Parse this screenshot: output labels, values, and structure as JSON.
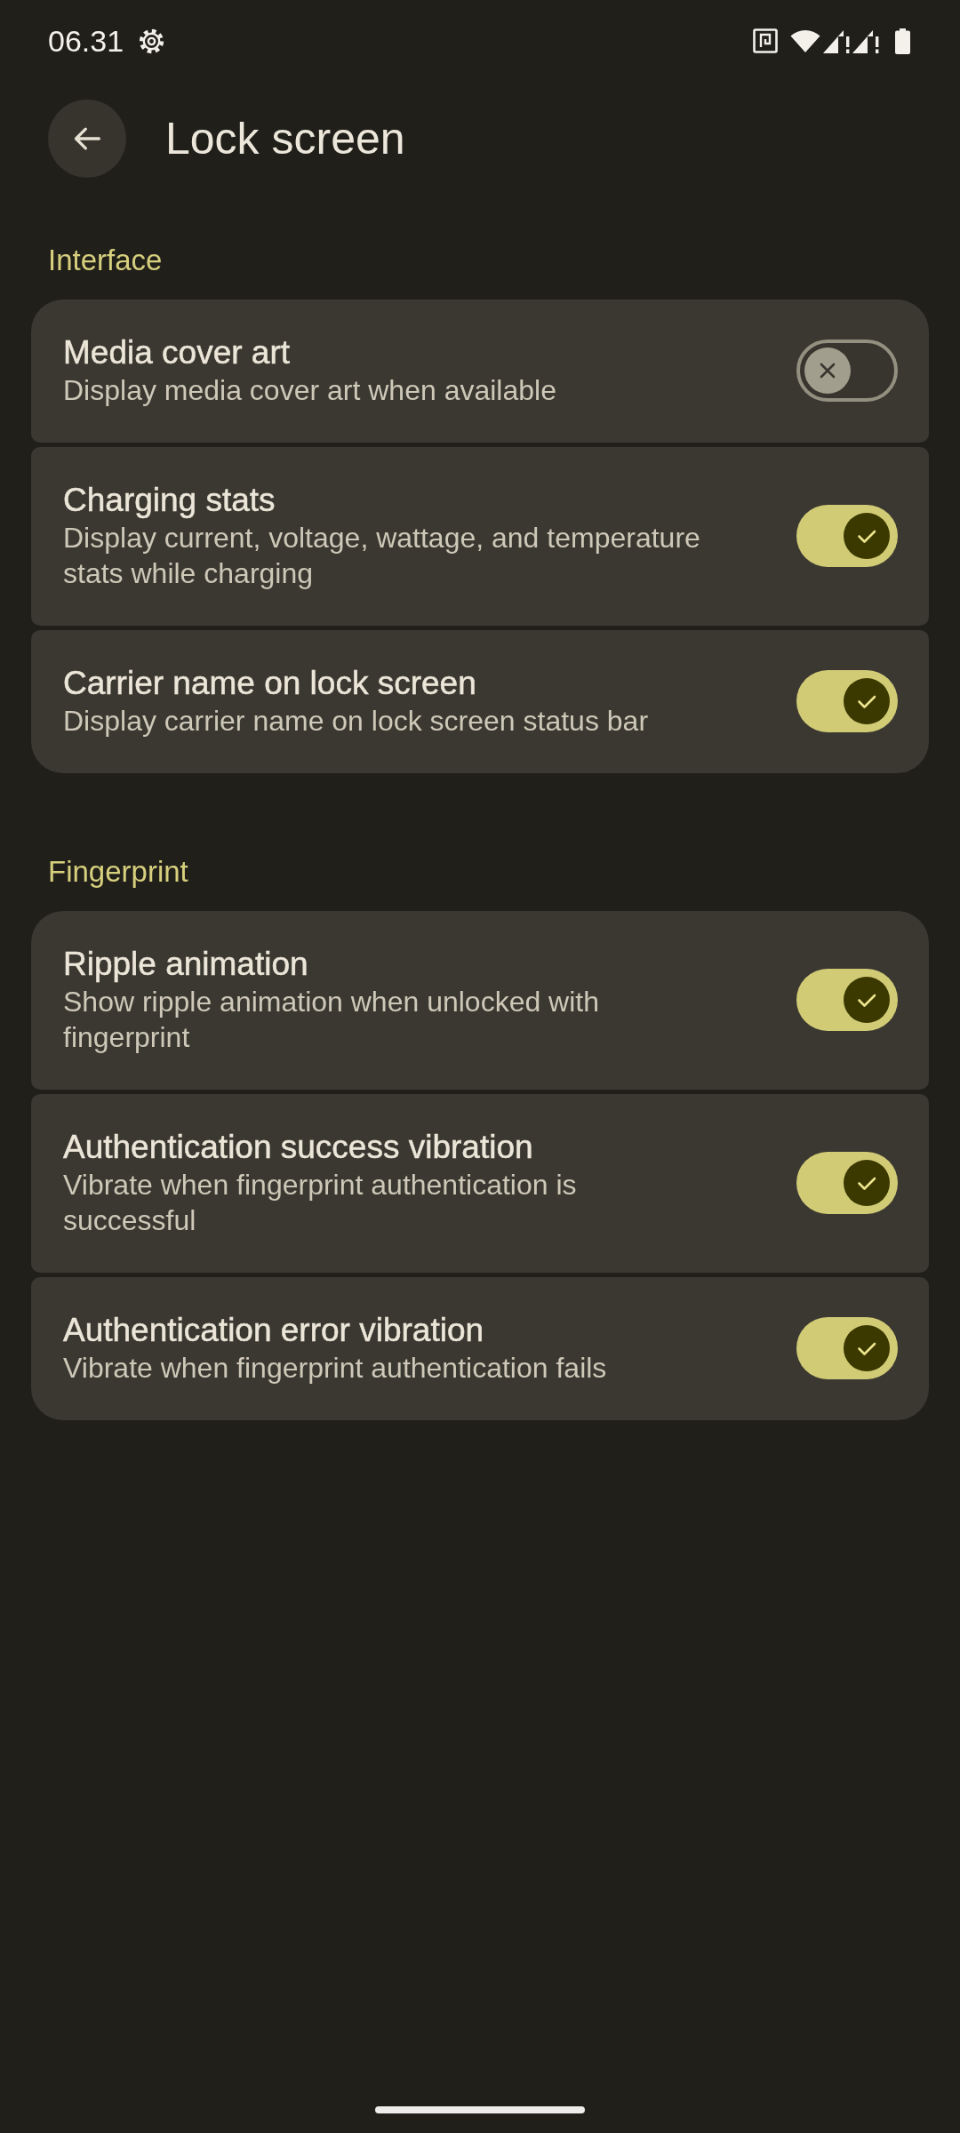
{
  "status_bar": {
    "time": "06.31"
  },
  "header": {
    "title": "Lock screen"
  },
  "sections": [
    {
      "label": "Interface",
      "rows": [
        {
          "title": "Media cover art",
          "subtitle": "Display media cover art when available",
          "on": false
        },
        {
          "title": "Charging stats",
          "subtitle": "Display current, voltage, wattage, and temperature stats while charging",
          "on": true
        },
        {
          "title": "Carrier name on lock screen",
          "subtitle": "Display carrier name on lock screen status bar",
          "on": true
        }
      ]
    },
    {
      "label": "Fingerprint",
      "rows": [
        {
          "title": "Ripple animation",
          "subtitle": "Show ripple animation when unlocked with fingerprint",
          "on": true
        },
        {
          "title": "Authentication success vibration",
          "subtitle": "Vibrate when fingerprint authentication is successful",
          "on": true
        },
        {
          "title": "Authentication error vibration",
          "subtitle": "Vibrate when fingerprint authentication fails",
          "on": true
        }
      ]
    }
  ]
}
